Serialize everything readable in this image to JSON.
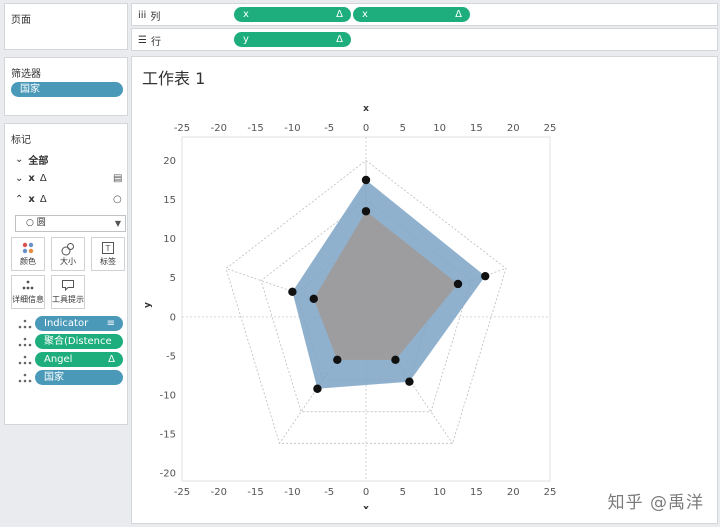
{
  "left": {
    "pages_title": "页面",
    "filters_title": "筛选器",
    "filters": [
      "国家"
    ],
    "marks_title": "标记",
    "mark_rows": [
      {
        "toggle": "⌄",
        "label": "全部",
        "delta": "",
        "right_icon": ""
      },
      {
        "toggle": "⌄",
        "label": "x",
        "delta": "Δ",
        "right_icon": "▤"
      },
      {
        "toggle": "⌃",
        "label": "x",
        "delta": "Δ",
        "right_icon": "○"
      }
    ],
    "mark_type": "圆",
    "cards": [
      "颜色",
      "大小",
      "标签",
      "详细信息",
      "工具提示"
    ],
    "mark_pills": [
      {
        "label": "Indicator",
        "color": "blue",
        "icon": "sort-icon",
        "glyph": "≡"
      },
      {
        "label": "聚合(Distence f..",
        "color": "green",
        "icon": "",
        "glyph": ""
      },
      {
        "label": "Angel",
        "color": "green",
        "icon": "delta-icon",
        "glyph": "Δ"
      },
      {
        "label": "国家",
        "color": "blue",
        "icon": "",
        "glyph": ""
      }
    ]
  },
  "shelves": {
    "columns_label": "列",
    "columns_pills": [
      "x",
      "x"
    ],
    "rows_label": "行",
    "rows_pills": [
      "y"
    ],
    "delta": "Δ"
  },
  "sheet": {
    "title": "工作表 1"
  },
  "chart_data": {
    "type": "scatter",
    "xlabel": "x",
    "ylabel": "y",
    "xlim": [
      -25,
      25
    ],
    "ylim": [
      -21,
      23
    ],
    "x_ticks": [
      -25,
      -20,
      -15,
      -10,
      -5,
      0,
      5,
      10,
      15,
      20,
      25
    ],
    "y_ticks": [
      20,
      15,
      10,
      5,
      0,
      -5,
      -10,
      -15,
      -20
    ],
    "x_tick_labels": [
      "-25",
      "-20",
      "-15",
      "-10",
      "-5",
      "0",
      "5",
      "10",
      "15",
      "20",
      "25"
    ],
    "y_tick_labels": [
      "20",
      "15",
      "10",
      "5",
      "0",
      "-5",
      "-10",
      "-15",
      "-20"
    ],
    "grid_levels": [
      5,
      10,
      15,
      20
    ],
    "series": [
      {
        "values": [
          [
            0,
            17.5
          ],
          [
            16.2,
            5.2
          ],
          [
            5.9,
            -8.3
          ],
          [
            -6.6,
            -9.2
          ],
          [
            -10,
            3.2
          ]
        ],
        "fill": "#7da3c6"
      },
      {
        "values": [
          [
            0,
            13.5
          ],
          [
            12.5,
            4.2
          ],
          [
            4,
            -5.5
          ],
          [
            -3.9,
            -5.5
          ],
          [
            -7.1,
            2.3
          ]
        ],
        "fill": "#9e9b9a"
      }
    ],
    "colors": {
      "outer_fill": "#7da3c6",
      "inner_fill": "#9e9b9a",
      "dot": "#111111",
      "grid": "#bcbcbc"
    }
  },
  "watermark": "知乎 @禹洋"
}
